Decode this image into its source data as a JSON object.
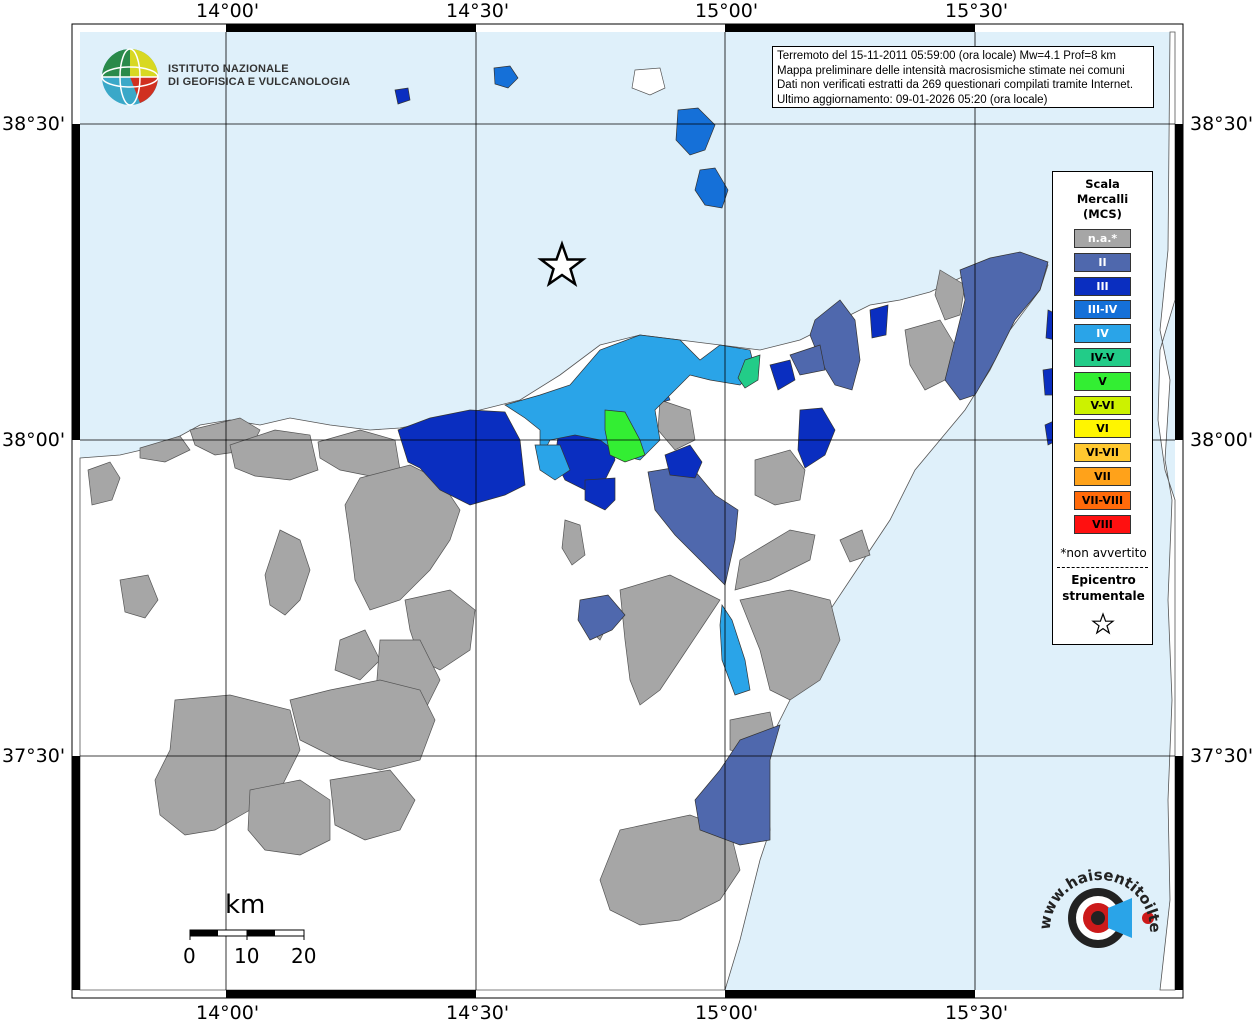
{
  "map": {
    "lon_labels": [
      "14°00'",
      "14°30'",
      "15°00'",
      "15°30'"
    ],
    "lat_labels": [
      "38°30'",
      "38°00'",
      "37°30'"
    ],
    "colors": {
      "sea": "#dff0fa",
      "land": "#ffffff",
      "na": "#a6a6a6",
      "II": "#4f68ad",
      "III": "#0a2ec0",
      "III_IV": "#1570d8",
      "IV": "#2aa4e8",
      "IV_V": "#22cc88",
      "V": "#33ee33"
    }
  },
  "institute": {
    "line1": "ISTITUTO NAZIONALE",
    "line2": "DI GEOFISICA E VULCANOLOGIA"
  },
  "info": {
    "line1": "Terremoto del 15-11-2011 05:59:00 (ora locale) Mw=4.1 Prof=8 km",
    "line2": "Mappa preliminare delle intensità macrosismiche stimate nei comuni",
    "line3": "Dati non verificati estratti da 269 questionari compilati tramite Internet.",
    "line4": "Ultimo aggiornamento: 09-01-2026 05:20 (ora locale)"
  },
  "legend": {
    "title_line1": "Scala",
    "title_line2": "Mercalli",
    "title_line3": "(MCS)",
    "items": [
      {
        "label": "n.a.*",
        "color": "#a6a6a6",
        "text_color": "#ffffff"
      },
      {
        "label": "II",
        "color": "#4f68ad",
        "text_color": "#ffffff"
      },
      {
        "label": "III",
        "color": "#0a2ec0",
        "text_color": "#ffffff"
      },
      {
        "label": "III-IV",
        "color": "#1570d8",
        "text_color": "#ffffff"
      },
      {
        "label": "IV",
        "color": "#2aa4e8",
        "text_color": "#ffffff"
      },
      {
        "label": "IV-V",
        "color": "#22cc88",
        "text_color": "#000000"
      },
      {
        "label": "V",
        "color": "#33ee33",
        "text_color": "#000000"
      },
      {
        "label": "V-VI",
        "color": "#ccf200",
        "text_color": "#000000"
      },
      {
        "label": "VI",
        "color": "#fff500",
        "text_color": "#000000"
      },
      {
        "label": "VI-VII",
        "color": "#ffc830",
        "text_color": "#000000"
      },
      {
        "label": "VII",
        "color": "#ffa21a",
        "text_color": "#000000"
      },
      {
        "label": "VII-VIII",
        "color": "#ff6a0a",
        "text_color": "#000000"
      },
      {
        "label": "VIII",
        "color": "#ff1010",
        "text_color": "#000000"
      }
    ],
    "na_note": "*non avvertito",
    "epicentre_line1": "Epicentro",
    "epicentre_line2": "strumentale"
  },
  "scalebar": {
    "unit": "km",
    "ticks": [
      "0",
      "10",
      "20"
    ]
  },
  "brand": {
    "text": "www.haisentitoilterremoto.it"
  }
}
